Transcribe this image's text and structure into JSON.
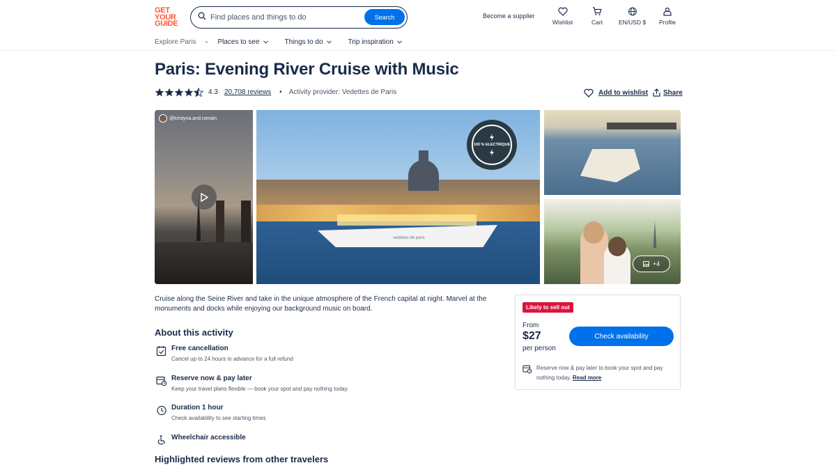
{
  "header": {
    "logo": [
      "GET",
      "YOUR",
      "GUIDE"
    ],
    "search_placeholder": "Find places and things to do",
    "search_button": "Search",
    "become_supplier": "Become a supplier",
    "nav": [
      {
        "label": "Wishlist",
        "icon": "heart-icon"
      },
      {
        "label": "Cart",
        "icon": "cart-icon"
      },
      {
        "label": "EN/USD $",
        "icon": "globe-icon"
      },
      {
        "label": "Profile",
        "icon": "user-icon"
      }
    ]
  },
  "subnav": {
    "explore": "Explore Paris",
    "items": [
      "Places to see",
      "Things to do",
      "Trip inspiration"
    ]
  },
  "activity": {
    "title": "Paris: Evening River Cruise with Music",
    "rating": "4.3",
    "rating_value": 4.3,
    "reviews": "20,708 reviews",
    "bullet": "•",
    "provider": "Activity provider: Vedettes de Paris",
    "add_to_wishlist": "Add to wishlist",
    "share": "Share"
  },
  "gallery": {
    "video_handle": "@kristyna.and.romain",
    "badge_text": "100 % ELECTRIQUE",
    "boat_label": "vedettes de paris",
    "more_photos": "+4"
  },
  "description": "Cruise along the Seine River and take in the unique atmosphere of the French capital at night. Marvel at the monuments and docks while enjoying our background music on board.",
  "about": {
    "heading": "About this activity",
    "features": [
      {
        "title": "Free cancellation",
        "subtitle": "Cancel up to 24 hours in advance for a full refund",
        "icon": "calendar-check-icon"
      },
      {
        "title": "Reserve now & pay later",
        "subtitle": "Keep your travel plans flexible — book your spot and pay nothing today.",
        "icon": "calendar-clock-icon"
      },
      {
        "title": "Duration 1 hour",
        "subtitle": "Check availability to see starting times",
        "icon": "clock-icon"
      },
      {
        "title": "Wheelchair accessible",
        "subtitle": "",
        "icon": "wheelchair-icon"
      }
    ]
  },
  "reviews_heading": "Highlighted reviews from other travelers",
  "booking": {
    "badge": "Likely to sell out",
    "from": "From",
    "price": "$27",
    "per_person": "per person",
    "check_availability": "Check availability",
    "reserve_text": "Reserve now & pay later to book your spot and pay nothing today.",
    "read_more": "Read more"
  },
  "colors": {
    "brand": "#ff5533",
    "primary": "#0071eb",
    "text": "#1a2b49",
    "alert": "#dc143c"
  }
}
